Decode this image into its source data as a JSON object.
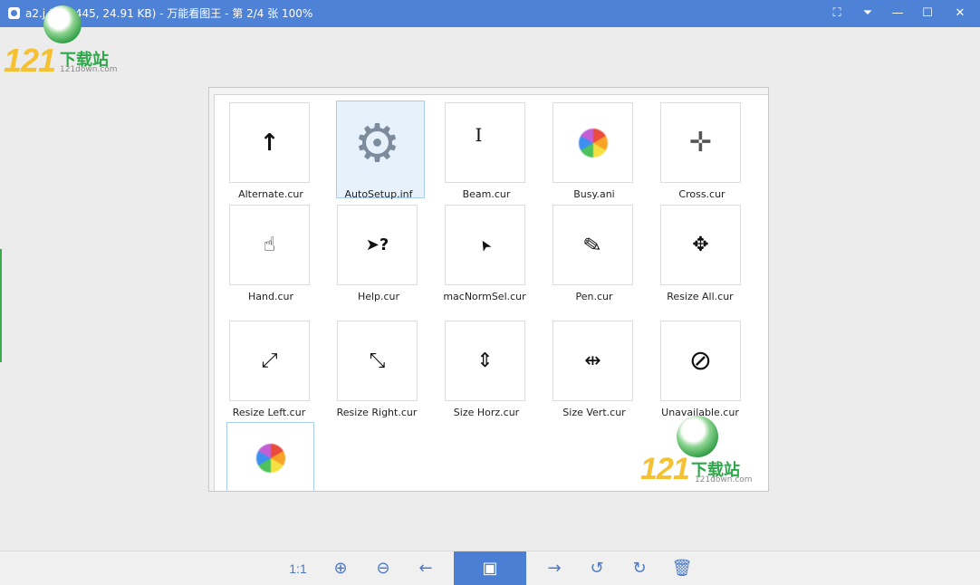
{
  "window": {
    "title": "a2.j  19 * 445, 24.91 KB) - 万能看图王 - 第 2/4 张 100%",
    "controls": {
      "fullscreen": "⛶",
      "menu": "⏷",
      "minimize": "—",
      "maximize": "☐",
      "close": "✕"
    }
  },
  "watermark": {
    "number": "121",
    "brand_cn": "下载站",
    "url": "121down.com"
  },
  "image": {
    "files": [
      {
        "name": "Alternate.cur",
        "icon": "arrow-up-icon",
        "glyph": "↑"
      },
      {
        "name": "AutoSetup.inf",
        "icon": "gear-document-icon",
        "glyph": "⚙",
        "selected": true
      },
      {
        "name": "Beam.cur",
        "icon": "text-beam-icon",
        "glyph": "I"
      },
      {
        "name": "Busy.ani",
        "icon": "busy-wheel-icon",
        "glyph": ""
      },
      {
        "name": "Cross.cur",
        "icon": "crosshair-icon",
        "glyph": "✛"
      },
      {
        "name": "Hand.cur",
        "icon": "hand-pointer-icon",
        "glyph": "☝"
      },
      {
        "name": "Help.cur",
        "icon": "help-pointer-icon",
        "glyph": "➤?"
      },
      {
        "name": "macNormSel.cur",
        "icon": "arrow-pointer-icon",
        "glyph": "➤"
      },
      {
        "name": "Pen.cur",
        "icon": "pen-icon",
        "glyph": "✎"
      },
      {
        "name": "Resize All.cur",
        "icon": "move-icon",
        "glyph": "✥"
      },
      {
        "name": "Resize Left.cur",
        "icon": "resize-diagonal-left-icon",
        "glyph": "⤢"
      },
      {
        "name": "Resize Right.cur",
        "icon": "resize-diagonal-right-icon",
        "glyph": "⤡"
      },
      {
        "name": "Size Horz.cur",
        "icon": "resize-vertical-icon",
        "glyph": "⇕"
      },
      {
        "name": "Size Vert.cur",
        "icon": "resize-horizontal-icon",
        "glyph": "⇹"
      },
      {
        "name": "Unavailable.cur",
        "icon": "unavailable-icon",
        "glyph": "⊘"
      },
      {
        "name": "",
        "icon": "busy-wheel-icon",
        "glyph": ""
      }
    ]
  },
  "toolbar": {
    "actual_size": "1:1",
    "zoom_in": "⊕",
    "zoom_out": "⊖",
    "prev": "←",
    "slideshow": "▣",
    "next": "→",
    "rotate_left": "↺",
    "rotate_right": "↻",
    "delete": "🗑"
  }
}
